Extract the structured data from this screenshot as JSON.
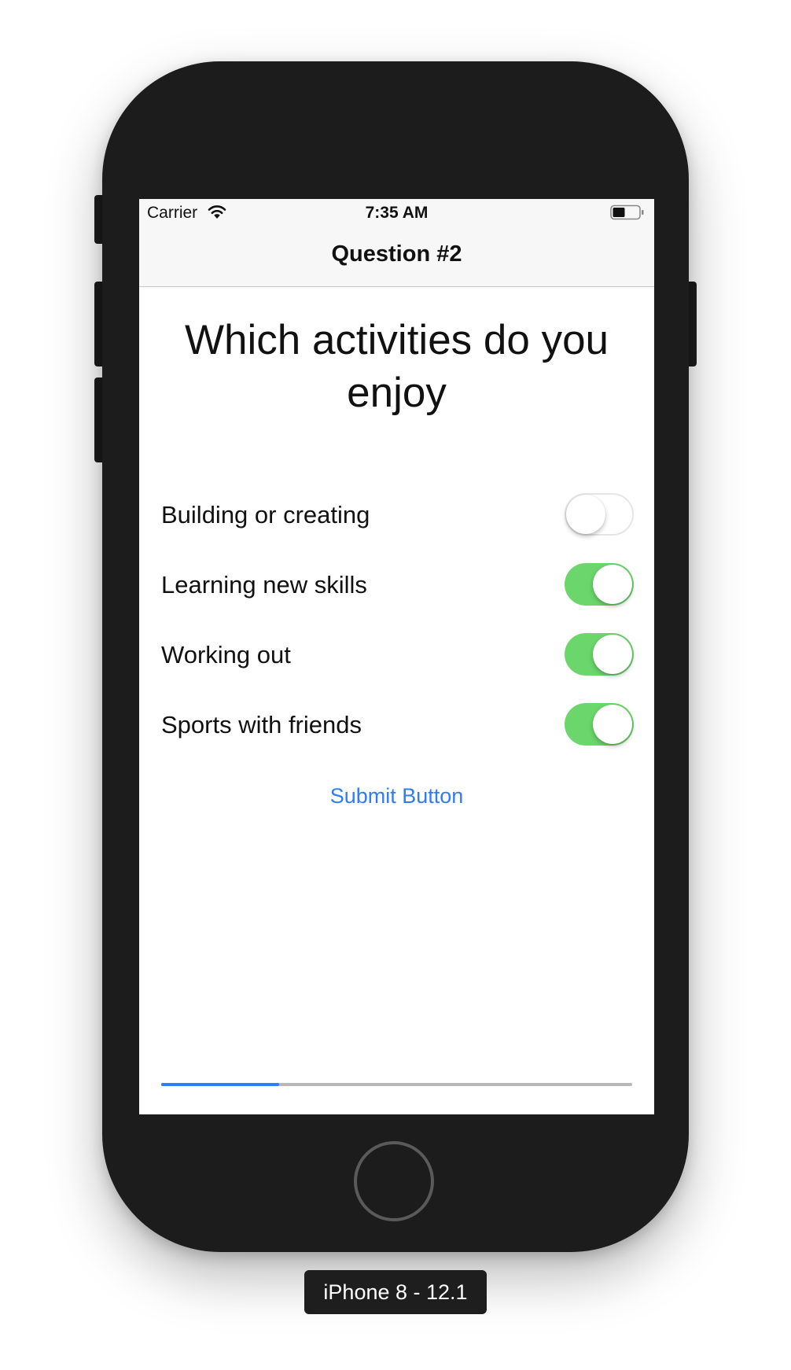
{
  "status_bar": {
    "carrier": "Carrier",
    "wifi_icon": "wifi-icon",
    "time": "7:35 AM",
    "battery_icon": "battery-icon"
  },
  "nav": {
    "title": "Question #2"
  },
  "question": {
    "text": "Which activities do you enjoy"
  },
  "options": [
    {
      "label": "Building or creating",
      "on": false
    },
    {
      "label": "Learning new skills",
      "on": true
    },
    {
      "label": "Working out",
      "on": true
    },
    {
      "label": "Sports with friends",
      "on": true
    }
  ],
  "submit": {
    "label": "Submit Button"
  },
  "progress": {
    "value": 0.25
  },
  "device": {
    "label": "iPhone 8 - 12.1"
  },
  "colors": {
    "accent": "#2f7cf6",
    "switch_on": "#6bd66b",
    "phone_body": "#1c1c1c"
  }
}
